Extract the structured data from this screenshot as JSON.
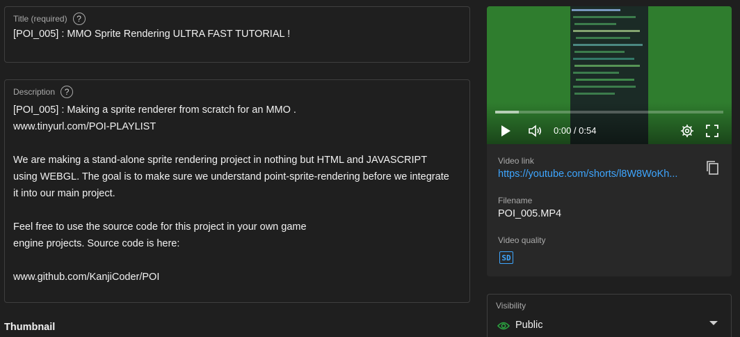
{
  "title_field": {
    "label": "Title (required)",
    "help_glyph": "?",
    "value": "[POI_005] : MMO Sprite Rendering ULTRA FAST TUTORIAL !"
  },
  "description_field": {
    "label": "Description",
    "help_glyph": "?",
    "lines": [
      "[POI_005] : Making a sprite renderer from scratch for an MMO .",
      "www.tinyurl.com/POI-PLAYLIST",
      "",
      "We are making a stand-alone sprite rendering project in nothing but HTML and JAVASCRIPT",
      "using WEBGL. The goal is to make sure we understand point-sprite-rendering before we integrate",
      "it into our main project.",
      "",
      "Feel free to use the source code for this project in your own game",
      "engine projects. Source code is here:",
      "",
      "www.github.com/KanjiCoder/POI"
    ]
  },
  "thumbnail": {
    "heading": "Thumbnail"
  },
  "video_player": {
    "time": "0:00 / 0:54",
    "progress_fraction": 0.0,
    "icons": [
      "play-icon",
      "volume-icon",
      "settings-gear-icon",
      "fullscreen-icon"
    ]
  },
  "video_info": {
    "link_label": "Video link",
    "link_value": "https://youtube.com/shorts/l8W8WoKh...",
    "filename_label": "Filename",
    "filename_value": "POI_005.MP4",
    "quality_label": "Video quality",
    "quality_badge": "SD"
  },
  "visibility": {
    "label": "Visibility",
    "value": "Public"
  },
  "colors": {
    "background": "#1f1f1f",
    "card": "#282828",
    "link": "#3ea6ff",
    "public_green": "#2ba640",
    "video_green": "#2f7d2e"
  }
}
